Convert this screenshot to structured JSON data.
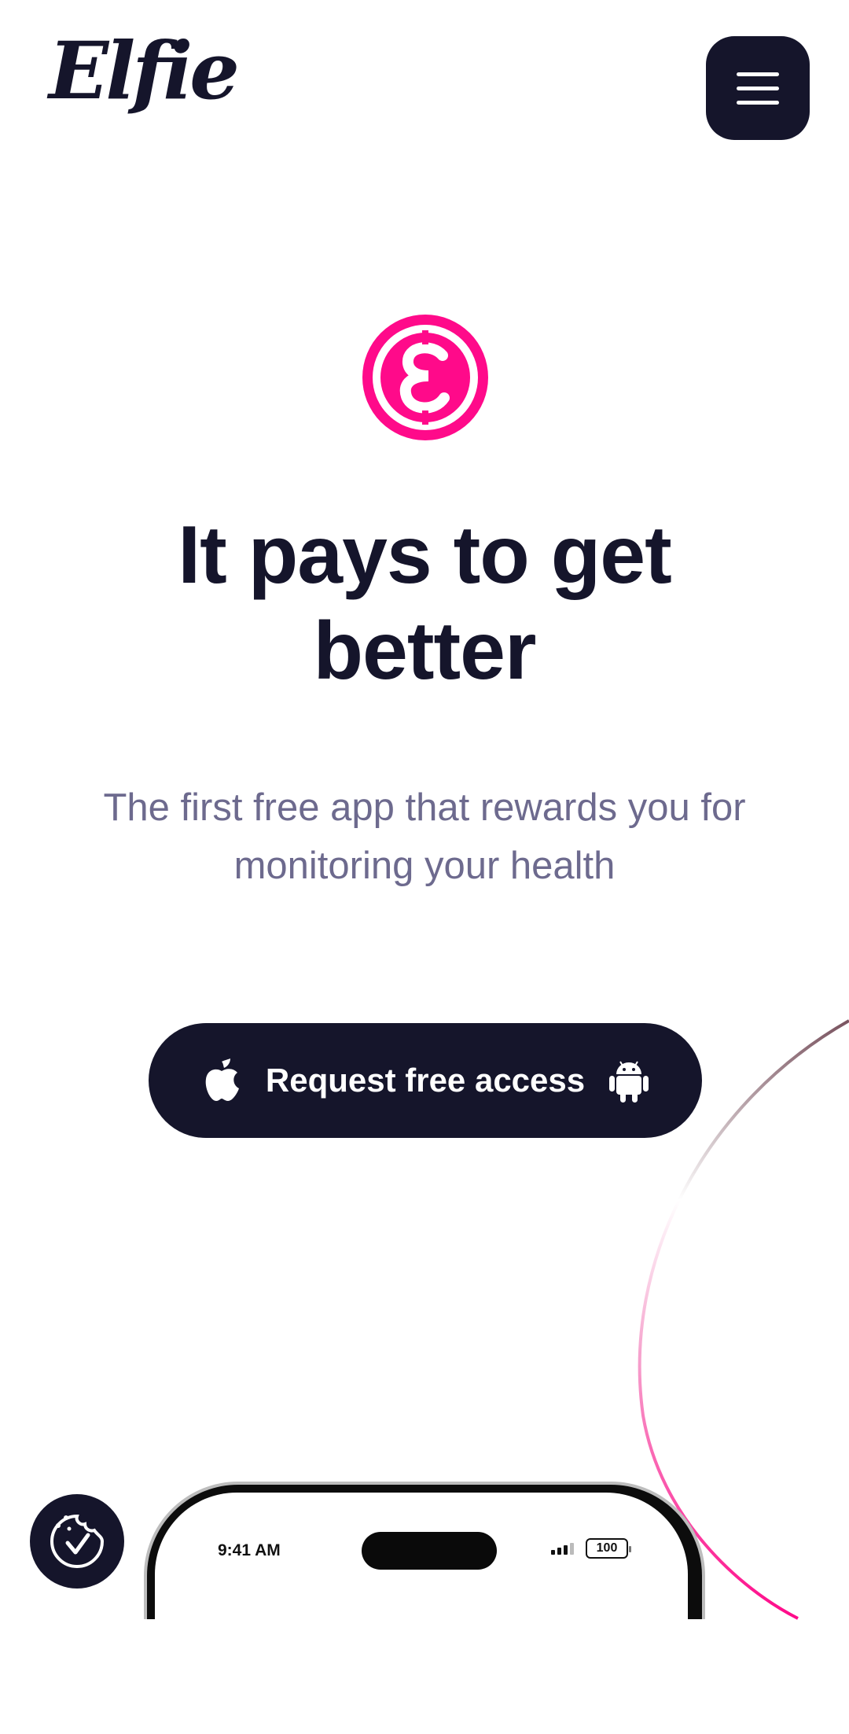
{
  "header": {
    "logo_text": "Elfie",
    "menu_icon": "hamburger-menu-icon"
  },
  "hero": {
    "brand_icon": "elfie-coin-icon",
    "title": "It pays to get better",
    "subtitle": "The first free app that rewards you for monitoring your health"
  },
  "cta": {
    "label": "Request free access",
    "left_icon": "apple-icon",
    "right_icon": "android-icon"
  },
  "cookie_button": {
    "icon": "cookie-consent-icon"
  },
  "phone_preview": {
    "time": "9:41 AM",
    "battery": "100"
  },
  "colors": {
    "navy": "#15152b",
    "brand_pink": "#ff0a8a",
    "subtitle_gray": "#6d6a8e"
  }
}
